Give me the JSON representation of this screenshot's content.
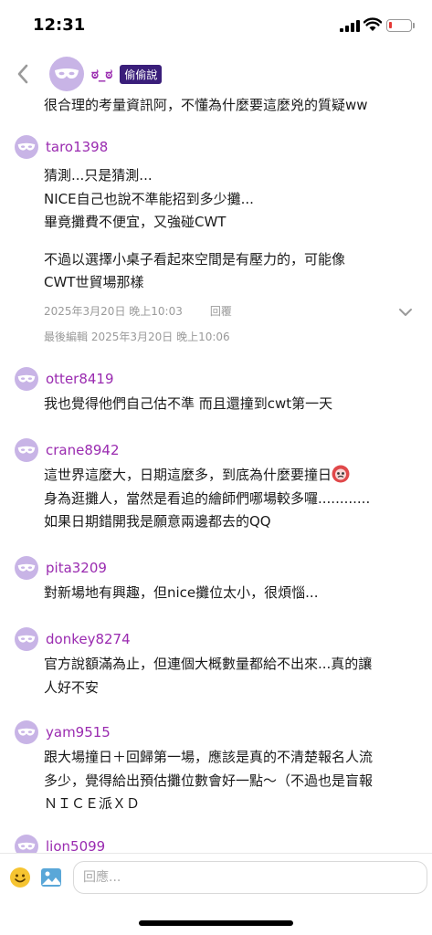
{
  "status_bar": {
    "time": "12:31",
    "battery_level": 0.15,
    "battery_color": "#e53935"
  },
  "post": {
    "author": "ಠ_ಠ",
    "badge": "偷偷說",
    "text": "很合理的考量資訊阿，不懂為什麼要這麼兇的質疑ww"
  },
  "comments": [
    {
      "user": "taro1398",
      "lines": [
        "猜測...只是猜測...",
        "NICE自己也說不準能招到多少攤...",
        "畢竟攤費不便宜，又強碰CWT",
        "",
        "不過以選擇小桌子看起來空間是有壓力的，可能像",
        "CWT世貿場那樣"
      ],
      "date": "2025年3月20日 晚上10:03",
      "reply_label": "回覆",
      "edited": "最後編輯 2025年3月20日 晚上10:06"
    },
    {
      "user": "otter8419",
      "lines": [
        "我也覺得他們自己估不準 而且還撞到cwt第一天"
      ]
    },
    {
      "user": "crane8942",
      "lines": [
        "這世界這麼大，日期這麼多，到底為什麼要撞日",
        "身為逛攤人，當然是看追的繪師們哪場較多囉............",
        "如果日期錯開我是願意兩邊都去的QQ"
      ],
      "emoji": "angry-face"
    },
    {
      "user": "pita3209",
      "lines": [
        "對新場地有興趣，但nice攤位太小，很煩惱..."
      ]
    },
    {
      "user": "donkey8274",
      "lines": [
        "官方說額滿為止，但連個大概數量都給不出來...真的讓",
        "人好不安"
      ]
    },
    {
      "user": "yam9515",
      "lines": [
        "跟大場撞日＋回歸第一場，應該是真的不清楚報名人流",
        "多少，覺得給出預估攤位數會好一點～（不過也是盲報",
        "ＮＩＣＥ派ＸＤ"
      ]
    },
    {
      "user": "lion5099",
      "lines": []
    }
  ],
  "reply_box": {
    "placeholder": "回應..."
  },
  "icons": {
    "back": "chevron-left-icon",
    "avatar": "anonymous-mask-icon",
    "expand": "chevron-down-icon",
    "emoji": "smiley-icon",
    "image": "image-icon"
  },
  "colors": {
    "username": "#9a2bb0",
    "badge": "#3a1e7a",
    "avatar_bg": "#c8b4e6"
  }
}
